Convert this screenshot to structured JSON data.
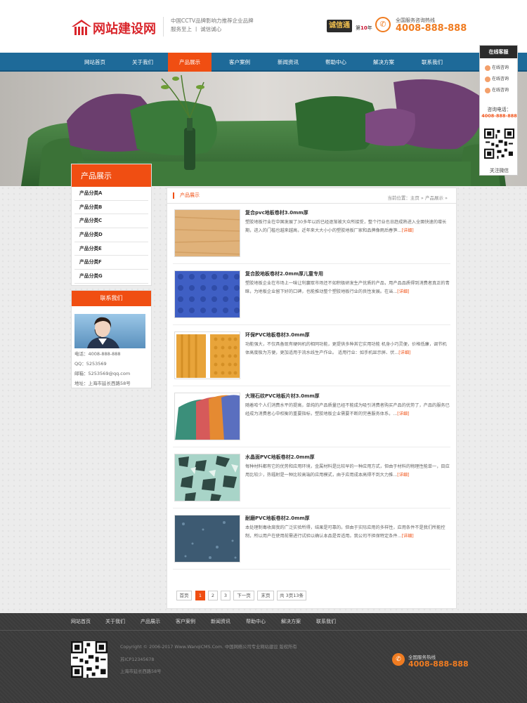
{
  "header": {
    "logo_text": "网站建设网",
    "slogan_line1": "中国CCTV品牌影响力推荐企业品牌",
    "slogan_line2": "服务至上 丨 诚信诚心",
    "badge_text": "诚信通",
    "years_prefix": "第",
    "years_num": "10",
    "years_suffix": "年",
    "hotline_label": "全国服务咨询热线",
    "hotline_number": "4008-888-888",
    "phone_glyph": "✆"
  },
  "nav": [
    "网站首页",
    "关于我们",
    "产品展示",
    "客户案例",
    "新闻资讯",
    "帮助中心",
    "解决方案",
    "联系我们"
  ],
  "sidebar": {
    "products_title": "产品展示",
    "categories": [
      "产品分类A",
      "产品分类B",
      "产品分类C",
      "产品分类D",
      "产品分类E",
      "产品分类F",
      "产品分类G"
    ],
    "contact_title": "联系我们",
    "contact": {
      "phone": "电话：4008-888-888",
      "qq": "QQ：5253569",
      "email": "邮箱：5253569@qq.com",
      "address": "地址：上海市延长西路58号"
    }
  },
  "main": {
    "title": "产品展示",
    "breadcrumb": "当前位置：主页 » 产品展示 »",
    "more": "[详细]",
    "products": [
      {
        "title": "复合pvc地板卷材3.0mm厚",
        "desc": "塑胶地板行业在中国发展了30多年以后已经逐渐被大众所接受，整个行业也日趋成熟进入全面快速的增长期，进入的门槛也越来越高，近年来大大小小的塑胶地板厂家和品牌像雨后春笋..."
      },
      {
        "title": "复合胶地板卷材2.0mm厚儿童专用",
        "desc": "塑胶地板企业在市场上一味让利赢取市场还不如积极研发生产优质的产品，用产品品质得到消费者真正的青睐，为地板企业留下好的口碑，也能推动整个塑胶地板行业的良性发展。在当..."
      },
      {
        "title": "环保PVC地板卷材3.0mm厚",
        "desc": "功能强大，不仅具备现有硬码机的相同功能，更提供多种其它实用功能 机身小巧灵便，价格低廉，调节机体高度极为方便，更加适用于流水线生产作业。 适用行业：如手机显示屏、伏..."
      },
      {
        "title": "大理石纹PVC地板片材3.0mm厚",
        "desc": "随着哈个人们消费水平的提高，单纯的产品质量已经不能成为吸引消费者购买产品的优势了，产品的服务已经成为消费者心中权衡的重要指标，塑胶地板企业需要不断的完善服务体系，..."
      },
      {
        "title": "水晶面PVC地板卷材2.0mm厚",
        "desc": "每种材料都有它的优势和应用环境，金属材料是比较早的一种应用方式，但由于材料的物理性能单一，目应用比较少，热辐射是一种比较高端的应用模式，由于应用成本高得不到大力推..."
      },
      {
        "title": "耐磨PVC地板卷材2.0mm厚",
        "desc": "本处理制毒收腐我的广泛实验所得，结果是可靠的。但由于实际应用的多样性，应用条件不是我们所能控制，所以用户在使用前需进行试验以确认本品是否适用。我公司不担保特定条件..."
      }
    ],
    "pagination": [
      "首页",
      "1",
      "2",
      "3",
      "下一页",
      "末页",
      "共 3页13条"
    ]
  },
  "service": {
    "title": "在线客服",
    "buttons": [
      "在线咨询",
      "在线咨询",
      "在线咨询"
    ],
    "phone_label": "咨询电话：",
    "phone": "4008-888-888",
    "wechat_label": "关注微信"
  },
  "footer": {
    "nav": [
      "网站首页",
      "关于我们",
      "产品展示",
      "客户案例",
      "新闻资讯",
      "帮助中心",
      "解决方案",
      "联系我们"
    ],
    "copyright": "Copyright © 2006-2017 Www.WanqiCMS.Com. 中国网络公司专业网站建设 版权所有",
    "icp": "苏ICP12345678",
    "address": "上海市延长西路58号",
    "hotline_label": "全国服务热线",
    "hotline": "4008-888-888"
  },
  "colors": {
    "accent": "#f04e12",
    "nav": "#1e6a99",
    "brand_red": "#d9262c",
    "phone": "#f07c21"
  }
}
